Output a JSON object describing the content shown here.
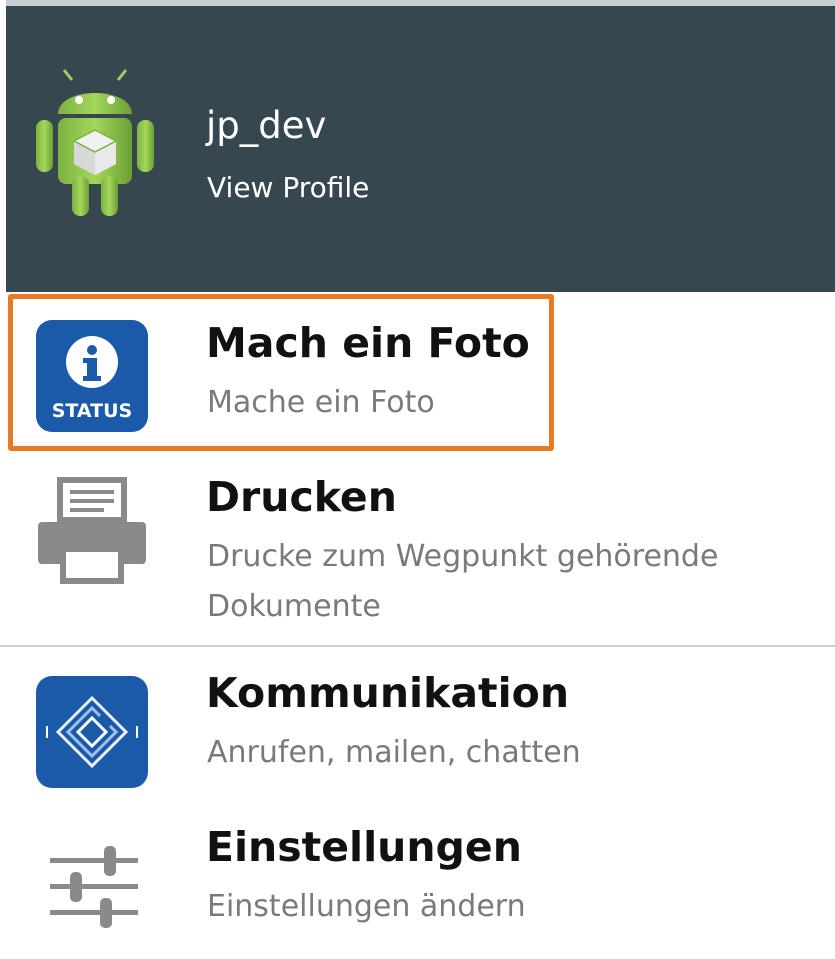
{
  "profile": {
    "username": "jp_dev",
    "view_profile_label": "View Profile",
    "avatar_icon": "android-robot-icon"
  },
  "menu": {
    "items": [
      {
        "title": "Mach ein Foto",
        "subtitle": "Mache ein Foto",
        "icon": "status-info-icon",
        "icon_label": "STATUS",
        "highlighted": true
      },
      {
        "title": "Drucken",
        "subtitle": "Drucke zum Wegpunkt gehörende Dokumente",
        "icon": "printer-icon"
      },
      {
        "title": "Kommunikation",
        "subtitle": "Anrufen, mailen, chatten",
        "icon": "communication-icon"
      },
      {
        "title": "Einstellungen",
        "subtitle": "Einstellungen ändern",
        "icon": "sliders-icon"
      }
    ]
  },
  "colors": {
    "header_bg": "#37474f",
    "highlight_border": "#e87a24",
    "icon_blue": "#1a5aa8"
  }
}
